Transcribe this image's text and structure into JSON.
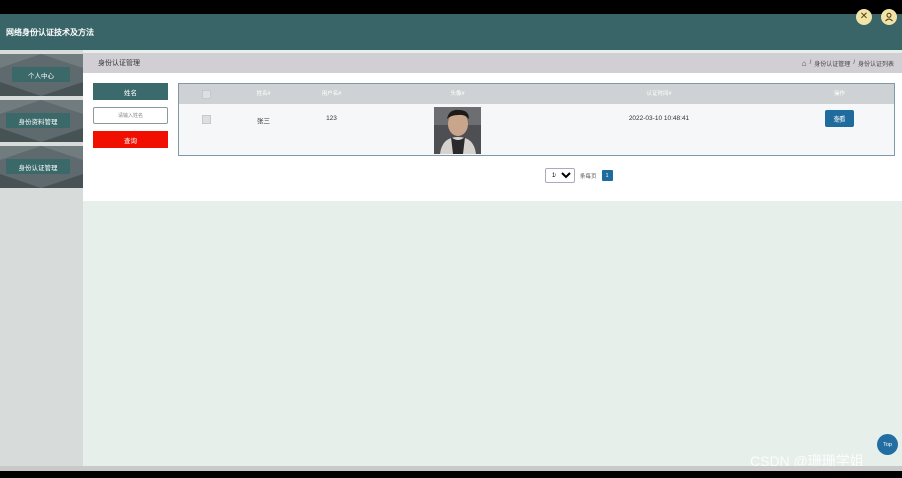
{
  "app": {
    "title": "网络身份认证技术及方法"
  },
  "header": {
    "close_icon": "close-circle-icon",
    "user_icon": "user-icon",
    "icon_color": "#f2e4a6"
  },
  "sidebar": {
    "items": [
      {
        "label": "个人中心"
      },
      {
        "label": "身份资料管理"
      },
      {
        "label": "身份认证管理"
      }
    ]
  },
  "page": {
    "title": "身份认证管理",
    "breadcrumb": [
      "身份认证管理",
      "身份认证列表"
    ],
    "breadcrumb_sep": "/"
  },
  "search": {
    "label": "姓名",
    "placeholder": "请输入姓名",
    "button": "查询"
  },
  "table": {
    "columns": [
      "姓名#",
      "用户名#",
      "头像#",
      "认证时间#",
      "操作"
    ],
    "rows": [
      {
        "name": "张三",
        "username": "123",
        "auth_time": "2022-03-10 10:48:41",
        "action": "查看"
      }
    ]
  },
  "pagination": {
    "page_size": "10",
    "page_size_options": [
      "10"
    ],
    "per_page_label": "条每页",
    "current_page": "1"
  },
  "top_button": "Top",
  "watermark": "CSDN @珊珊学姐",
  "colors": {
    "header": "#3a6568",
    "accent": "#1f6b9d",
    "danger": "#f00f00",
    "sidebar_label": "#3b6869"
  }
}
